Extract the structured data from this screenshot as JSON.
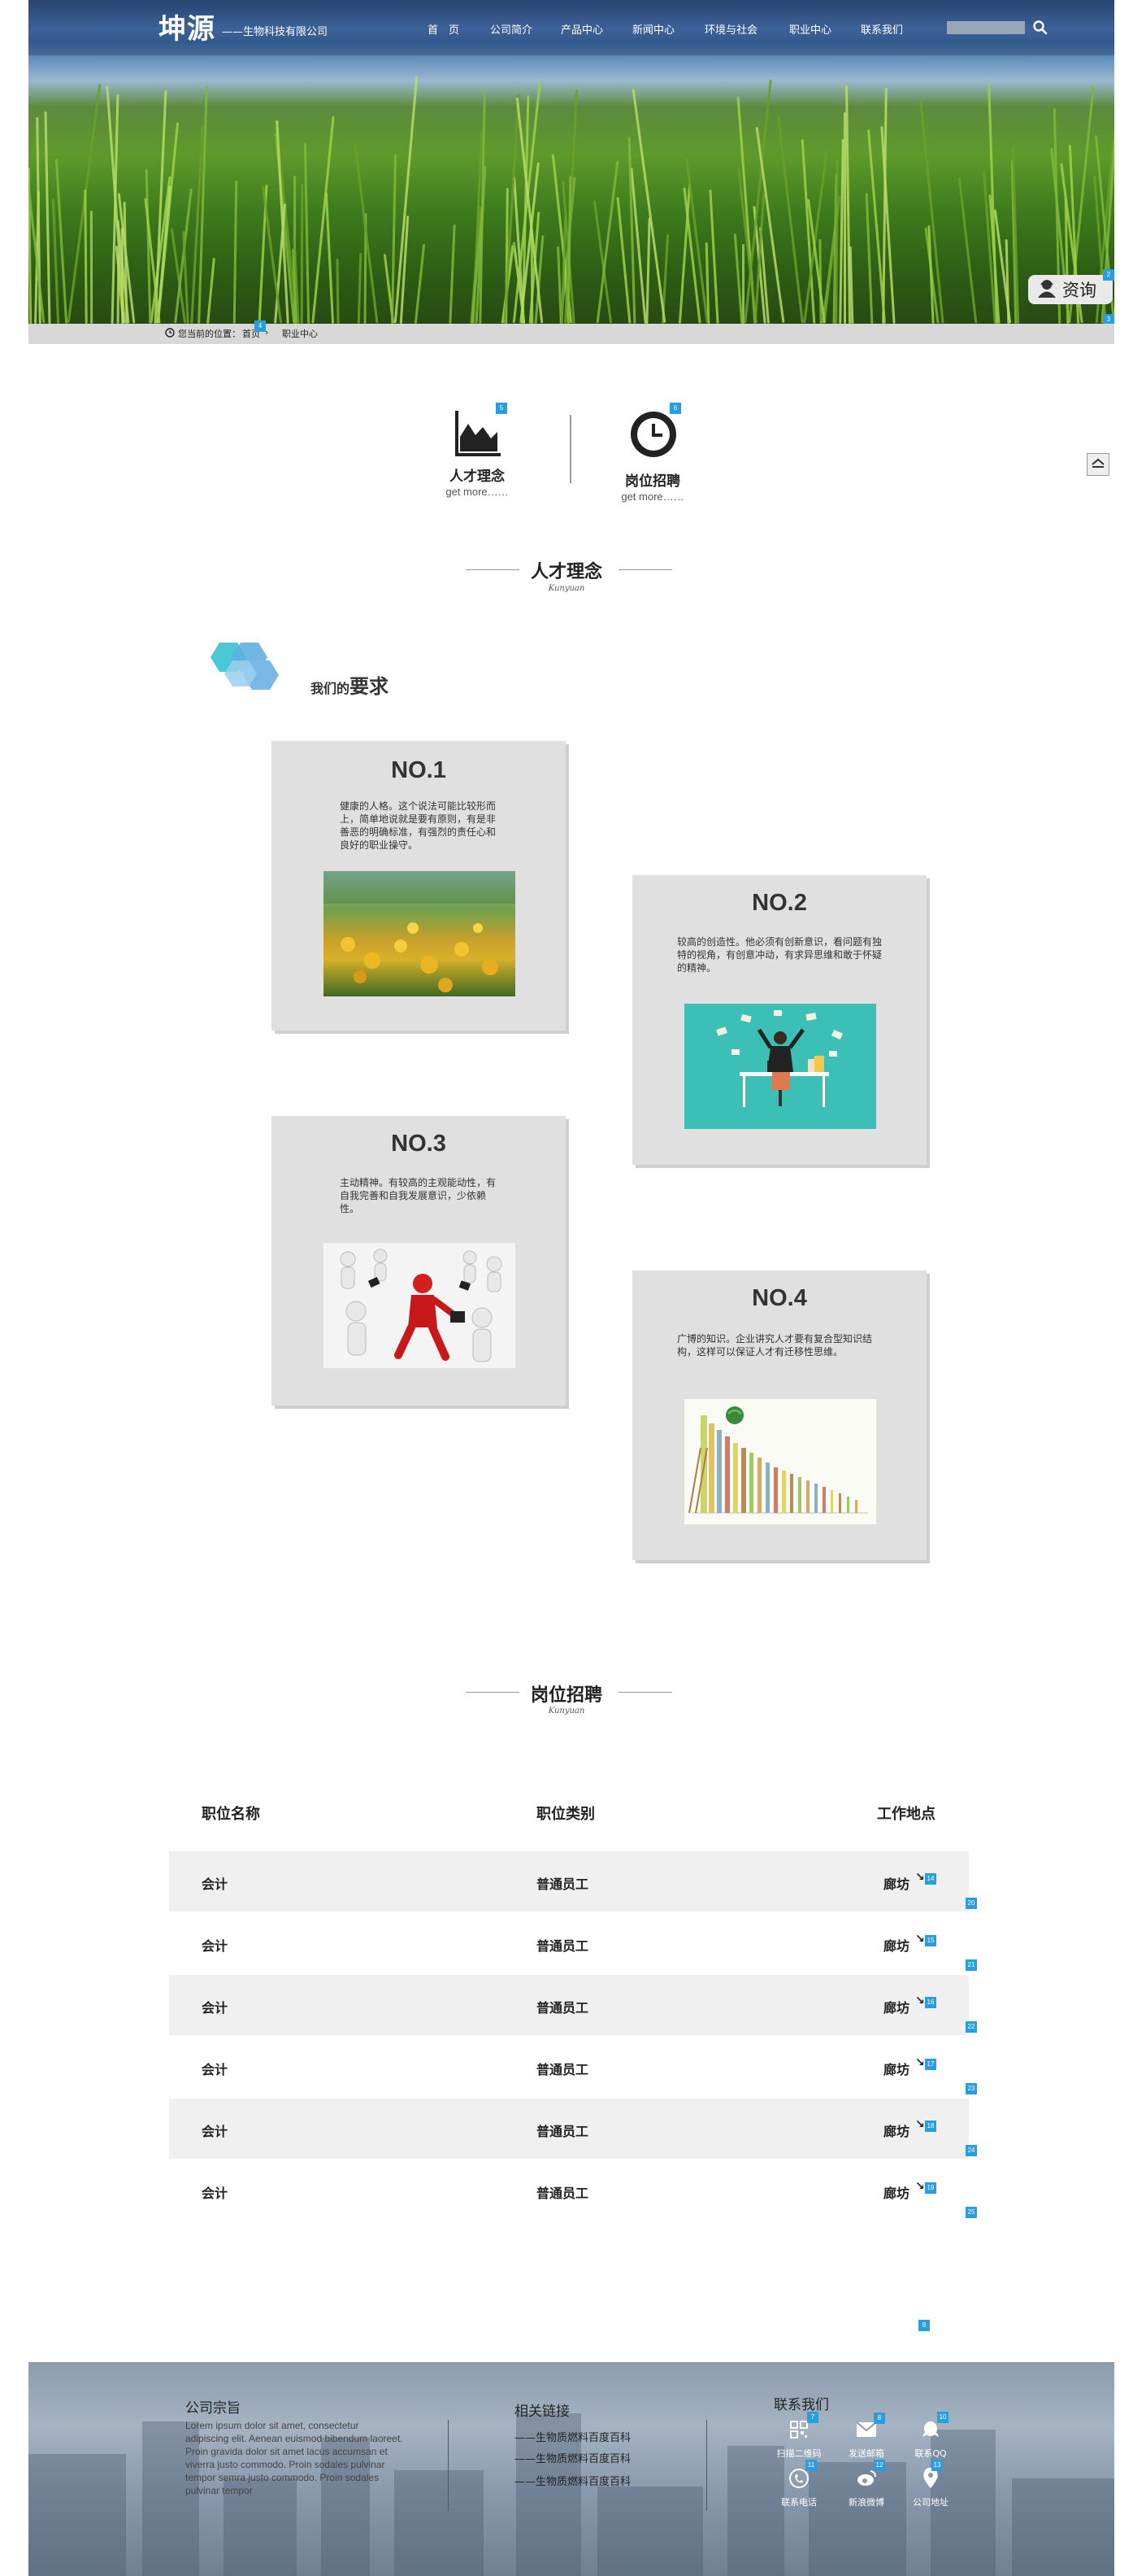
{
  "header": {
    "logo": "坤源",
    "logo_sub": "——生物科技有限公司",
    "nav": [
      "首　页",
      "公司简介",
      "产品中心",
      "新闻中心",
      "环境与社会",
      "职业中心",
      "联系我们"
    ],
    "search": {
      "placeholder": "",
      "value": ""
    }
  },
  "consult": {
    "label": "资询"
  },
  "breadcrumb": {
    "prefix": "您当前的位置：",
    "home": "首页",
    "current": "职业中心"
  },
  "tabs": [
    {
      "title": "人才理念",
      "more": "get more……",
      "badge": "5"
    },
    {
      "title": "岗位招聘",
      "more": "get more……",
      "badge": "6"
    }
  ],
  "section1": {
    "title": "人才理念",
    "subtitle": "Kunyuan"
  },
  "requirements": {
    "prefix": "我们的",
    "title": "要求"
  },
  "cards": [
    {
      "no": "NO.1",
      "text": "健康的人格。这个说法可能比较形而上，简单地说就是要有原则，有是非善恶的明确标准，有强烈的责任心和良好的职业操守。"
    },
    {
      "no": "NO.2",
      "text": "较高的创造性。他必须有创新意识，看问题有独特的视角，有创意冲动，有求异思维和敢于怀疑的精神。"
    },
    {
      "no": "NO.3",
      "text": "主动精神。有较高的主观能动性，有自我完善和自我发展意识，少依赖性。"
    },
    {
      "no": "NO.4",
      "text": "广博的知识。企业讲究人才要有复合型知识结构，这样可以保证人才有迁移性思维。"
    }
  ],
  "section2": {
    "title": "岗位招聘",
    "subtitle": "Kunyuan"
  },
  "jobs": {
    "headers": [
      "职位名称",
      "职位类别",
      "工作地点"
    ],
    "rows": [
      {
        "name": "会计",
        "type": "普通员工",
        "place": "廊坊"
      },
      {
        "name": "会计",
        "type": "普通员工",
        "place": "廊坊"
      },
      {
        "name": "会计",
        "type": "普通员工",
        "place": "廊坊"
      },
      {
        "name": "会计",
        "type": "普通员工",
        "place": "廊坊"
      },
      {
        "name": "会计",
        "type": "普通员工",
        "place": "廊坊"
      },
      {
        "name": "会计",
        "type": "普通员工",
        "place": "廊坊"
      }
    ],
    "row_badges": [
      "14",
      "15",
      "16",
      "17",
      "18",
      "19"
    ],
    "side_badges": [
      "20",
      "21",
      "22",
      "23",
      "24",
      "25"
    ]
  },
  "footer": {
    "about_title": "公司宗旨",
    "about_text": "Lorem ipsum dolor sit amet, consectetur adipiscing elit. Aenean euismod bibendum laoreet. Proin gravida dolor sit amet lacus accumsan et viverra justo commodo. Proin sodales pulvinar tempor semra justo commodo. Proin sodales pulvinar tempor",
    "links_title": "相关链接",
    "links": [
      "——生物质燃料百度百科",
      "——生物质燃料百度百科",
      "——生物质燃料百度百科"
    ],
    "contact_title": "联系我们",
    "contact": [
      {
        "label": "扫描二维码",
        "icon": "qrcode-icon",
        "badge": "7"
      },
      {
        "label": "发送邮箱",
        "icon": "mail-icon",
        "badge": "8"
      },
      {
        "label": "联系QQ",
        "icon": "qq-icon",
        "badge": "10"
      },
      {
        "label": "联系电话",
        "icon": "phone-icon",
        "badge": "11"
      },
      {
        "label": "新浪微博",
        "icon": "weibo-icon",
        "badge": "12"
      },
      {
        "label": "公司地址",
        "icon": "location-icon",
        "badge": "13"
      }
    ]
  },
  "misc_badges": {
    "breadcrumb": "4",
    "hero_right_top": "2",
    "hero_right_bottom": "3",
    "footer_top": "8"
  },
  "colors": {
    "accent_blue": "#2a9ce0",
    "card_bg": "#e0e0e0",
    "stripe": "#f0f0f0",
    "hex_teal": "#4bc8d8"
  }
}
